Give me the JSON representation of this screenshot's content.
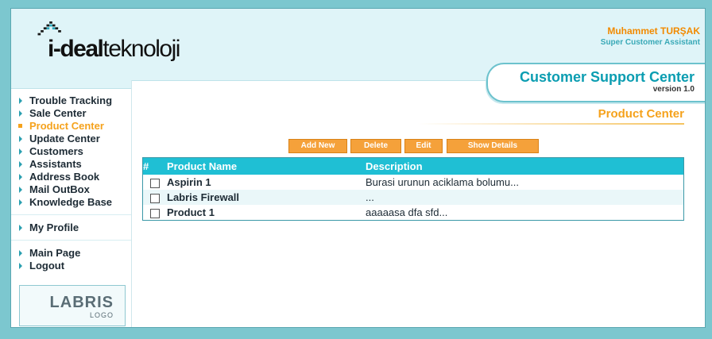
{
  "header": {
    "logo_text_bold": "i-deal",
    "logo_text_light": "teknoloji",
    "user_name": "Muhammet TURŞAK",
    "user_role": "Super Customer Assistant",
    "app_title": "Customer Support Center",
    "version": "version 1.0"
  },
  "sidebar": {
    "group1": [
      {
        "label": "Trouble Tracking",
        "active": false
      },
      {
        "label": "Sale Center",
        "active": false
      },
      {
        "label": "Product Center",
        "active": true
      },
      {
        "label": "Update Center",
        "active": false
      },
      {
        "label": "Customers",
        "active": false
      },
      {
        "label": "Assistants",
        "active": false
      },
      {
        "label": "Address Book",
        "active": false
      },
      {
        "label": "Mail OutBox",
        "active": false
      },
      {
        "label": "Knowledge Base",
        "active": false
      }
    ],
    "group2": [
      {
        "label": "My Profile"
      }
    ],
    "group3": [
      {
        "label": "Main Page"
      },
      {
        "label": "Logout"
      }
    ],
    "brand_logo": {
      "line1": "LABRIS",
      "line2": "LOGO"
    }
  },
  "main": {
    "section_title": "Product Center",
    "buttons": {
      "add_new": "Add New",
      "delete": "Delete",
      "edit": "Edit",
      "show_details": "Show Details"
    },
    "table": {
      "columns": [
        "#",
        "Product Name",
        "Description"
      ],
      "rows": [
        {
          "name": "Aspirin 1",
          "description": "Burasi urunun aciklama bolumu..."
        },
        {
          "name": "Labris Firewall",
          "description": "..."
        },
        {
          "name": "Product 1",
          "description": "aaaaasa dfa sfd..."
        }
      ]
    }
  },
  "colors": {
    "accent_orange": "#f5a21c",
    "accent_teal": "#1fbfd4",
    "header_bg": "#dff4f8"
  }
}
